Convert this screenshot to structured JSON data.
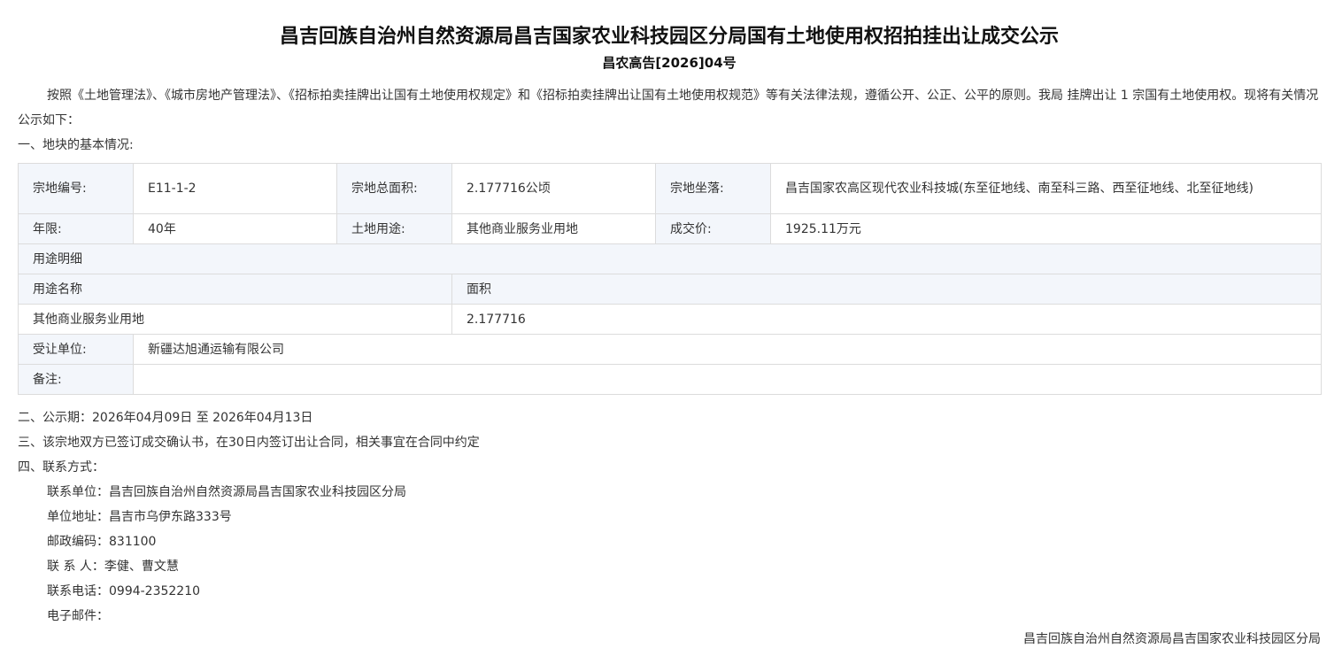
{
  "title": "昌吉回族自治州自然资源局昌吉国家农业科技园区分局国有土地使用权招拍挂出让成交公示",
  "doc_number": "昌农高告[2026]04号",
  "intro": "按照《土地管理法》、《城市房地产管理法》、《招标拍卖挂牌出让国有土地使用权规定》和《招标拍卖挂牌出让国有土地使用权规范》等有关法律法规，遵循公开、公正、公平的原则。我局 挂牌出让 1 宗国有土地使用权。现将有关情况公示如下：",
  "section1": "一、地块的基本情况:",
  "table": {
    "parcel_no_label": "宗地编号:",
    "parcel_no": "E11-1-2",
    "total_area_label": "宗地总面积:",
    "total_area": "2.177716公顷",
    "location_label": "宗地坐落:",
    "location": "昌吉国家农高区现代农业科技城(东至征地线、南至科三路、西至征地线、北至征地线)",
    "term_label": "年限:",
    "term": "40年",
    "land_use_label": "土地用途:",
    "land_use": "其他商业服务业用地",
    "price_label": "成交价:",
    "price": "1925.11万元",
    "usage_detail_label": "用途明细",
    "usage_name_header": "用途名称",
    "area_header": "面积",
    "usage_rows": [
      {
        "name": "其他商业服务业用地",
        "area": "2.177716"
      }
    ],
    "assignee_label": "受让单位:",
    "assignee": "新疆达旭通运输有限公司",
    "remark_label": "备注:",
    "remark": ""
  },
  "section2": "二、公示期：2026年04月09日 至 2026年04月13日",
  "section3": "三、该宗地双方已签订成交确认书，在30日内签订出让合同，相关事宜在合同中约定",
  "section4": "四、联系方式：",
  "contact": {
    "unit": "联系单位：昌吉回族自治州自然资源局昌吉国家农业科技园区分局",
    "address": "单位地址：昌吉市乌伊东路333号",
    "postcode": "邮政编码：831100",
    "person": "联 系 人：李健、曹文慧",
    "phone": "联系电话：0994-2352210",
    "email": "电子邮件："
  },
  "footer_org": "昌吉回族自治州自然资源局昌吉国家农业科技园区分局"
}
